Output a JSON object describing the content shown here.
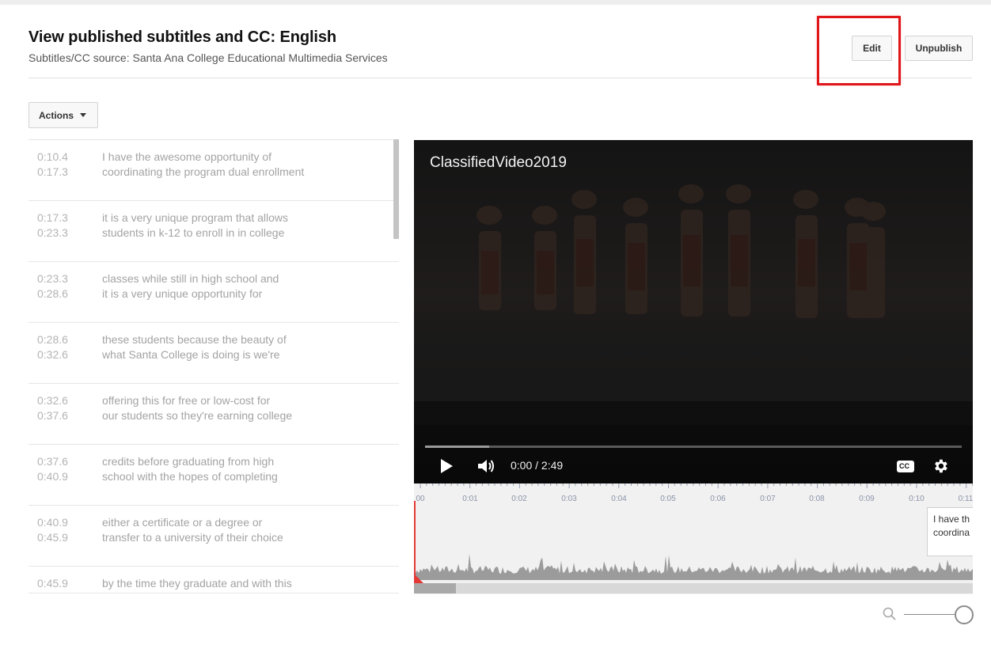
{
  "header": {
    "title": "View published subtitles and CC: English",
    "subtitle": "Subtitles/CC source: Santa Ana College Educational Multimedia Services",
    "edit_label": "Edit",
    "unpublish_label": "Unpublish"
  },
  "toolbar": {
    "actions_label": "Actions"
  },
  "transcript": {
    "cues": [
      {
        "start": "0:10.4",
        "end": "0:17.3",
        "line1": "I have the awesome opportunity of",
        "line2": "coordinating the program dual enrollment"
      },
      {
        "start": "0:17.3",
        "end": "0:23.3",
        "line1": "it is a very unique program that allows",
        "line2": "students in k-12 to enroll in in college"
      },
      {
        "start": "0:23.3",
        "end": "0:28.6",
        "line1": "classes while still in high school and",
        "line2": "it is a very unique opportunity for"
      },
      {
        "start": "0:28.6",
        "end": "0:32.6",
        "line1": "these students because the beauty of",
        "line2": "what Santa College is doing is we're"
      },
      {
        "start": "0:32.6",
        "end": "0:37.6",
        "line1": "offering this for free or low-cost for",
        "line2": "our students so they're earning college"
      },
      {
        "start": "0:37.6",
        "end": "0:40.9",
        "line1": "credits before graduating from high",
        "line2": "school with the hopes of completing"
      },
      {
        "start": "0:40.9",
        "end": "0:45.9",
        "line1": "either a certificate or a degree or",
        "line2": "transfer to a university of their choice"
      },
      {
        "start": "0:45.9",
        "end": "",
        "line1": "by the time they graduate and with this",
        "line2": ""
      }
    ]
  },
  "player": {
    "video_title": "ClassifiedVideo2019",
    "time_readout": "0:00 / 2:49",
    "cc_label": "CC",
    "progress_fraction": 0.12
  },
  "timeline": {
    "ticks": [
      "00",
      "0:01",
      "0:02",
      "0:03",
      "0:04",
      "0:05",
      "0:06",
      "0:07",
      "0:08",
      "0:09",
      "0:10",
      "0:11"
    ],
    "cue_preview_line1": "I have th",
    "cue_preview_line2": "coordina"
  },
  "colors": {
    "highlight": "#e0161b",
    "playhead": "#e53935"
  },
  "icons": {
    "play": "play-icon",
    "volume": "volume-icon",
    "cc": "cc-icon",
    "settings": "gear-icon",
    "zoom": "search-icon"
  }
}
